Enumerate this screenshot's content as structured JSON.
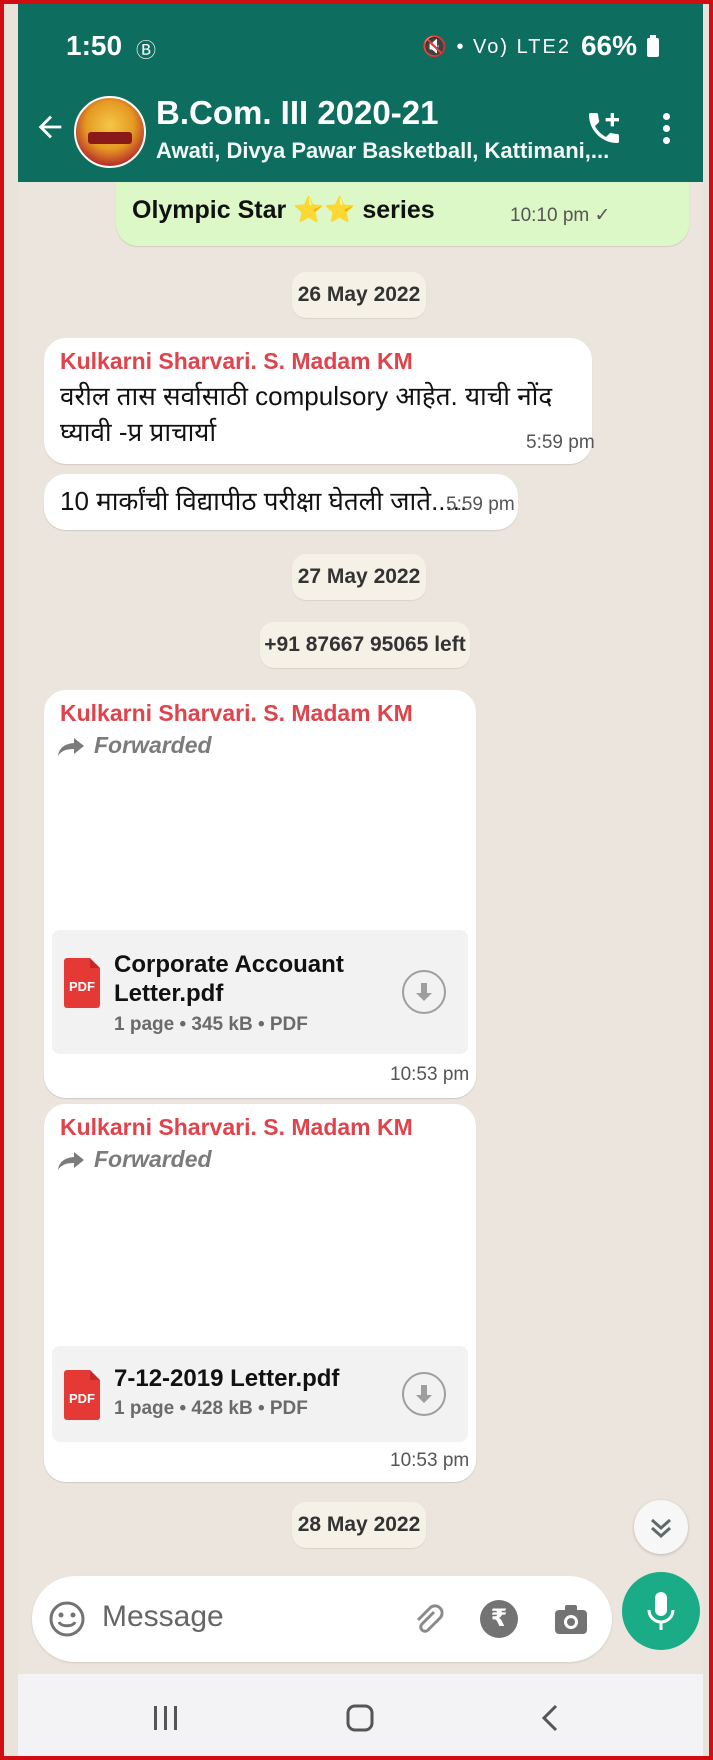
{
  "status_bar": {
    "time": "1:50",
    "left_icons": "Ⓑ",
    "right_icons": "🔇 • Vo) LTE2",
    "battery": "66%"
  },
  "chat_header": {
    "title": "B.Com. III 2020-21",
    "subtitle": "Awati, Divya Pawar Basketball, Kattimani,..."
  },
  "messages": {
    "out_1": {
      "text": "Olympic Star ⭐⭐ series",
      "time": "10:10 pm ✓"
    },
    "date_1": "26 May 2022",
    "msg_1": {
      "sender": "Kulkarni Sharvari. S. Madam KM",
      "text": "वरील तास सर्वासाठी compulsory आहेत.  याची नोंद घ्यावी -प्र प्राचार्या",
      "time": "5:59 pm"
    },
    "msg_2": {
      "text": "10 मार्कांची विद्यापीठ परीक्षा घेतली जाते.....",
      "time": "5:59 pm"
    },
    "date_2": "27 May 2022",
    "system_1": "+91 87667 95065 left",
    "doc_1": {
      "sender": "Kulkarni Sharvari. S. Madam KM",
      "forwarded": "Forwarded",
      "pdf_icon": "PDF",
      "name_line1": "Corporate Accouant",
      "name_line2": "Letter.pdf",
      "meta": "1 page • 345 kB • PDF",
      "time": "10:53 pm"
    },
    "doc_2": {
      "sender": "Kulkarni Sharvari. S. Madam KM",
      "forwarded": "Forwarded",
      "pdf_icon": "PDF",
      "name_line1": "7-12-2019 Letter.pdf",
      "meta": "1 page • 428 kB • PDF",
      "time": "10:53 pm"
    },
    "date_3": "28 May 2022"
  },
  "input": {
    "placeholder": "Message",
    "rupee": "₹"
  },
  "colors": {
    "header": "#0d6e5f",
    "sender": "#e0434b",
    "mic": "#1aab87",
    "outgoing": "#dcf8c6",
    "frame": "#d10d14"
  },
  "icons": [
    "back-arrow-icon",
    "group-avatar",
    "add-call-icon",
    "more-vert-icon",
    "forward-icon",
    "pdf-icon",
    "download-icon",
    "scroll-down-icon",
    "emoji-icon",
    "attach-icon",
    "rupee-icon",
    "camera-icon",
    "mic-icon",
    "recents-icon",
    "home-icon",
    "nav-back-icon"
  ]
}
